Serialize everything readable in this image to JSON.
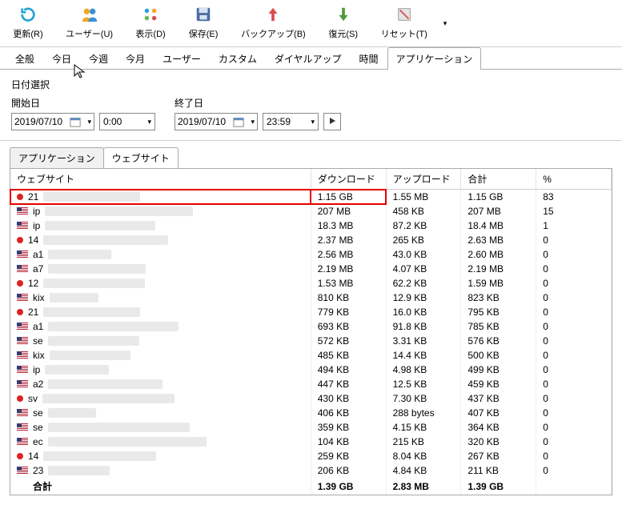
{
  "toolbar": [
    {
      "id": "refresh",
      "label": "更新(R)"
    },
    {
      "id": "user",
      "label": "ユーザー(U)"
    },
    {
      "id": "view",
      "label": "表示(D)"
    },
    {
      "id": "save",
      "label": "保存(E)"
    },
    {
      "id": "backup",
      "label": "バックアップ(B)"
    },
    {
      "id": "restore",
      "label": "復元(S)"
    },
    {
      "id": "reset",
      "label": "リセット(T)"
    }
  ],
  "tabs": {
    "items": [
      "全般",
      "今日",
      "今週",
      "今月",
      "ユーザー",
      "カスタム",
      "ダイヤルアップ",
      "時間",
      "アプリケーション"
    ],
    "active": 8
  },
  "datePanel": {
    "title": "日付選択",
    "start": {
      "label": "開始日",
      "date": "2019/07/10",
      "time": "0:00"
    },
    "end": {
      "label": "終了日",
      "date": "2019/07/10",
      "time": "23:59"
    }
  },
  "subtabs": {
    "items": [
      "アプリケーション",
      "ウェブサイト"
    ],
    "active": 1
  },
  "columns": [
    "ウェブサイト",
    "ダウンロード",
    "アップロード",
    "合計",
    "%"
  ],
  "rows": [
    {
      "icon": "red",
      "name": "21",
      "dl": "1.15 GB",
      "ul": "1.55 MB",
      "sum": "1.15 GB",
      "pct": "83",
      "hl": true
    },
    {
      "icon": "us",
      "name": "ip",
      "dl": "207 MB",
      "ul": "458 KB",
      "sum": "207 MB",
      "pct": "15"
    },
    {
      "icon": "us",
      "name": "ip",
      "dl": "18.3 MB",
      "ul": "87.2 KB",
      "sum": "18.4 MB",
      "pct": "1"
    },
    {
      "icon": "red",
      "name": "14",
      "dl": "2.37 MB",
      "ul": "265 KB",
      "sum": "2.63 MB",
      "pct": "0"
    },
    {
      "icon": "us",
      "name": "a1",
      "dl": "2.56 MB",
      "ul": "43.0 KB",
      "sum": "2.60 MB",
      "pct": "0"
    },
    {
      "icon": "us",
      "name": "a7",
      "dl": "2.19 MB",
      "ul": "4.07 KB",
      "sum": "2.19 MB",
      "pct": "0"
    },
    {
      "icon": "red",
      "name": "12",
      "dl": "1.53 MB",
      "ul": "62.2 KB",
      "sum": "1.59 MB",
      "pct": "0"
    },
    {
      "icon": "us",
      "name": "kix",
      "dl": "810 KB",
      "ul": "12.9 KB",
      "sum": "823 KB",
      "pct": "0"
    },
    {
      "icon": "red",
      "name": "21",
      "dl": "779 KB",
      "ul": "16.0 KB",
      "sum": "795 KB",
      "pct": "0"
    },
    {
      "icon": "us",
      "name": "a1",
      "dl": "693 KB",
      "ul": "91.8 KB",
      "sum": "785 KB",
      "pct": "0"
    },
    {
      "icon": "us",
      "name": "se",
      "dl": "572 KB",
      "ul": "3.31 KB",
      "sum": "576 KB",
      "pct": "0"
    },
    {
      "icon": "us",
      "name": "kix",
      "dl": "485 KB",
      "ul": "14.4 KB",
      "sum": "500 KB",
      "pct": "0"
    },
    {
      "icon": "us",
      "name": "ip",
      "dl": "494 KB",
      "ul": "4.98 KB",
      "sum": "499 KB",
      "pct": "0"
    },
    {
      "icon": "us",
      "name": "a2",
      "dl": "447 KB",
      "ul": "12.5 KB",
      "sum": "459 KB",
      "pct": "0"
    },
    {
      "icon": "red",
      "name": "sv",
      "dl": "430 KB",
      "ul": "7.30 KB",
      "sum": "437 KB",
      "pct": "0"
    },
    {
      "icon": "us",
      "name": "se",
      "dl": "406 KB",
      "ul": "288 bytes",
      "sum": "407 KB",
      "pct": "0"
    },
    {
      "icon": "us",
      "name": "se",
      "dl": "359 KB",
      "ul": "4.15 KB",
      "sum": "364 KB",
      "pct": "0"
    },
    {
      "icon": "us",
      "name": "ec",
      "dl": "104 KB",
      "ul": "215 KB",
      "sum": "320 KB",
      "pct": "0"
    },
    {
      "icon": "red",
      "name": "14",
      "dl": "259 KB",
      "ul": "8.04 KB",
      "sum": "267 KB",
      "pct": "0"
    },
    {
      "icon": "us",
      "name": "23",
      "dl": "206 KB",
      "ul": "4.84 KB",
      "sum": "211 KB",
      "pct": "0"
    }
  ],
  "total": {
    "label": "合計",
    "dl": "1.39 GB",
    "ul": "2.83 MB",
    "sum": "1.39 GB",
    "pct": ""
  }
}
